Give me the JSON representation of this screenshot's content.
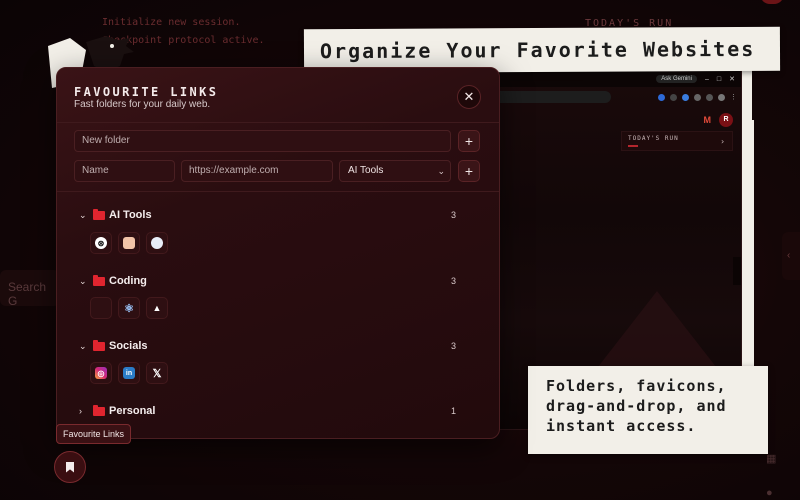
{
  "background": {
    "session_lines": [
      "Initialize new session.",
      "Checkpoint protocol active."
    ],
    "todays_run_label": "TODAY'S RUN",
    "search_placeholder": "Search G"
  },
  "browser": {
    "gemini_label": "Ask Gemini",
    "avatar_letter": "R",
    "run_card_title": "TODAY'S RUN"
  },
  "captions": {
    "top": "Organize Your Favorite Websites",
    "bottom": "Folders, favicons, drag-and-drop, and instant access."
  },
  "panel": {
    "title": "FAVOURITE LINKS",
    "subtitle": "Fast folders for your daily web.",
    "new_folder_placeholder": "New folder",
    "name_placeholder": "Name",
    "url_placeholder": "https://example.com",
    "folder_select_value": "AI Tools",
    "add_glyph": "+",
    "close_glyph": "✕"
  },
  "folders": [
    {
      "name": "AI Tools",
      "count": "3",
      "expanded": true,
      "favicons": [
        "openai-icon",
        "claude-icon",
        "gemini-icon"
      ]
    },
    {
      "name": "Coding",
      "count": "3",
      "expanded": true,
      "favicons": [
        "blank-site-icon",
        "react-icon",
        "vercel-icon"
      ]
    },
    {
      "name": "Socials",
      "count": "3",
      "expanded": true,
      "favicons": [
        "instagram-icon",
        "linkedin-icon",
        "x-icon"
      ]
    },
    {
      "name": "Personal",
      "count": "1",
      "expanded": false,
      "favicons": []
    }
  ],
  "footer": {
    "tooltip": "Favourite Links"
  },
  "colors": {
    "accent": "#e0252f",
    "panel_bg": "#2a0d10",
    "paper": "#f2efe8"
  }
}
